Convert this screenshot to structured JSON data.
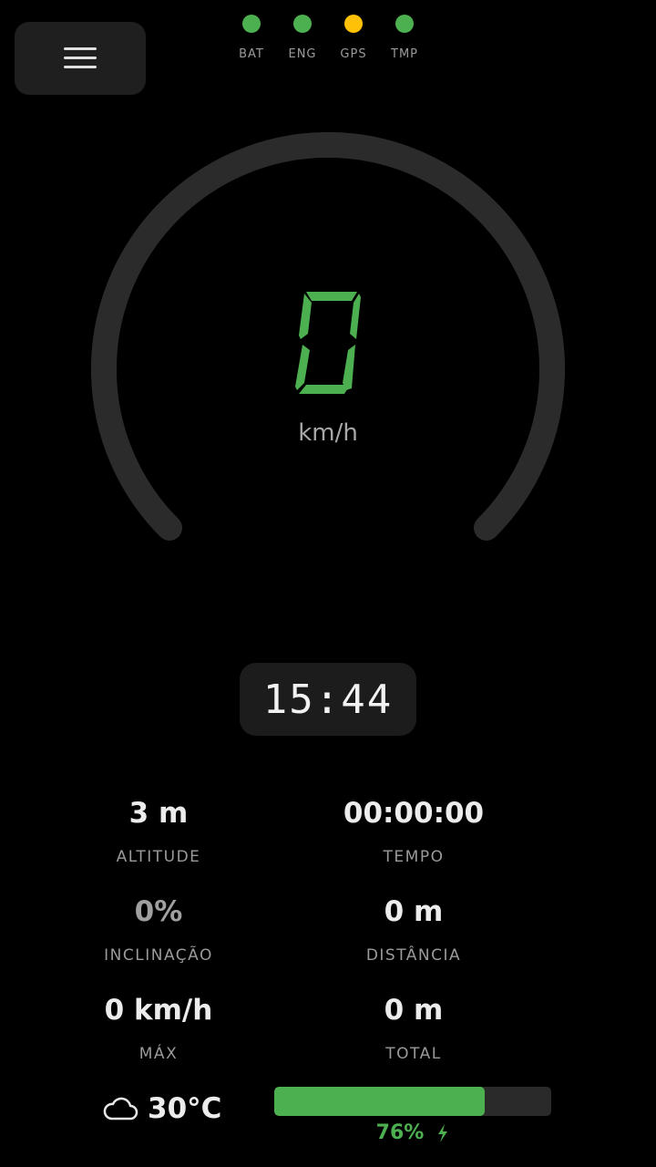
{
  "menu": {
    "icon": "hamburger-icon"
  },
  "indicators": [
    {
      "label": "BAT",
      "color": "#4caf50"
    },
    {
      "label": "ENG",
      "color": "#4caf50"
    },
    {
      "label": "GPS",
      "color": "#ffc107"
    },
    {
      "label": "TMP",
      "color": "#4caf50"
    }
  ],
  "speed": {
    "value": "0",
    "unit": "km/h",
    "digit_color": "#4caf50"
  },
  "clock": {
    "time": "15:44"
  },
  "stats": {
    "altitude": {
      "value": "3 m",
      "label": "ALTITUDE"
    },
    "tempo": {
      "value": "00:00:00",
      "label": "TEMPO"
    },
    "inclinacao": {
      "value": "0%",
      "label": "INCLINAÇÃO"
    },
    "distancia": {
      "value": "0 m",
      "label": "DISTÂNCIA"
    },
    "max": {
      "value": "0 km/h",
      "label": "MÁX"
    },
    "total": {
      "value": "0 m",
      "label": "TOTAL"
    }
  },
  "weather": {
    "icon": "cloud-icon",
    "temperature": "30°C"
  },
  "battery": {
    "percent_text": "76%",
    "level": 0.76,
    "charging_icon": "bolt-icon",
    "color": "#4caf50"
  }
}
